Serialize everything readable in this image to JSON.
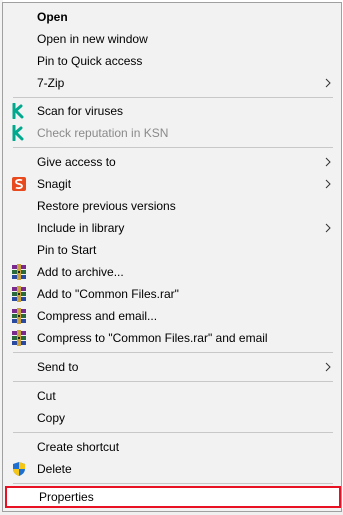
{
  "menu": {
    "items": [
      {
        "label": "Open"
      },
      {
        "label": "Open in new window"
      },
      {
        "label": "Pin to Quick access"
      },
      {
        "label": "7-Zip"
      },
      {
        "label": "Scan for viruses"
      },
      {
        "label": "Check reputation in KSN"
      },
      {
        "label": "Give access to"
      },
      {
        "label": "Snagit"
      },
      {
        "label": "Restore previous versions"
      },
      {
        "label": "Include in library"
      },
      {
        "label": "Pin to Start"
      },
      {
        "label": "Add to archive..."
      },
      {
        "label": "Add to \"Common Files.rar\""
      },
      {
        "label": "Compress and email..."
      },
      {
        "label": "Compress to \"Common Files.rar\" and email"
      },
      {
        "label": "Send to"
      },
      {
        "label": "Cut"
      },
      {
        "label": "Copy"
      },
      {
        "label": "Create shortcut"
      },
      {
        "label": "Delete"
      },
      {
        "label": "Properties"
      }
    ]
  },
  "colors": {
    "kaspersky": "#00a88e",
    "snagit": "#e8491d",
    "highlight_border": "#e81123"
  }
}
